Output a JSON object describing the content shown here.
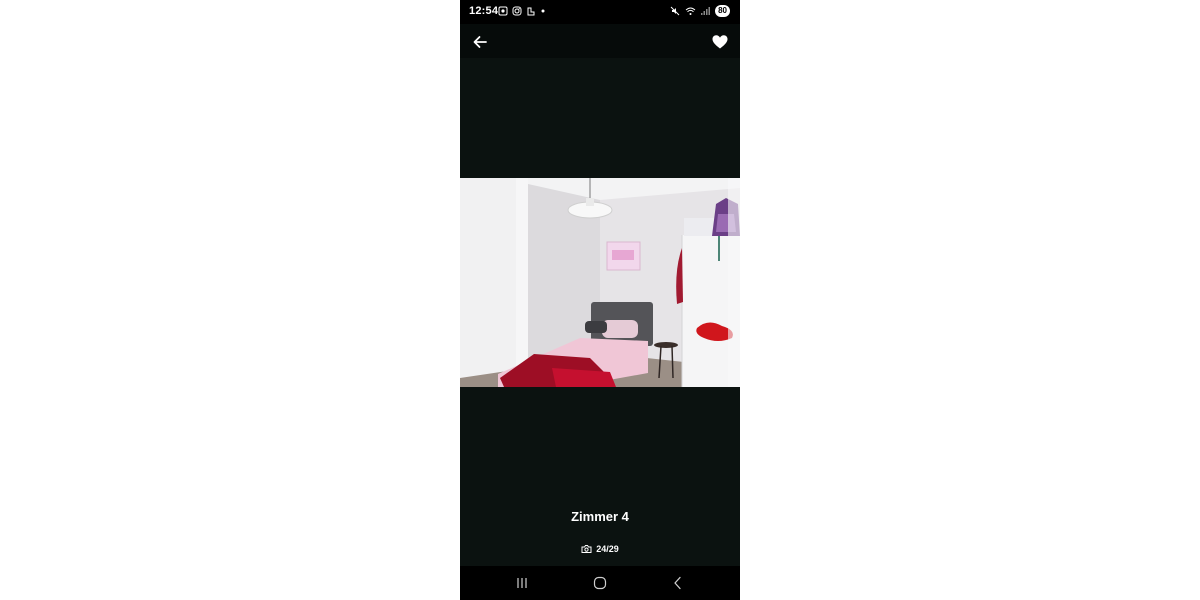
{
  "status_bar": {
    "time": "12:54",
    "battery": "80",
    "icons_left": [
      "screenshot-icon",
      "instagram-icon",
      "app-notification-icon",
      "dot-icon"
    ],
    "icons_right": [
      "mute-icon",
      "wifi-icon",
      "signal-icon"
    ]
  },
  "top_bar": {
    "back_icon": "arrow-left-icon",
    "favorite_icon": "heart-icon"
  },
  "photo": {
    "description_icon": "photo-bedroom"
  },
  "caption": {
    "title": "Zimmer 4"
  },
  "counter": {
    "icon": "camera-icon",
    "text": "24/29"
  },
  "nav_bar": {
    "items": [
      "recent-apps-icon",
      "home-icon",
      "back-icon"
    ]
  },
  "colors": {
    "background": "#0b1210",
    "text": "#ffffff"
  }
}
